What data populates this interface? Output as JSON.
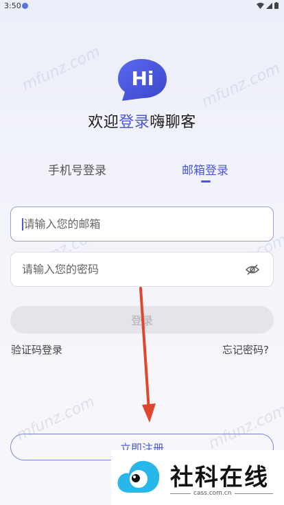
{
  "status_bar": {
    "time": "3:50"
  },
  "logo": {
    "text": "Hi",
    "color": "#4b57d6"
  },
  "welcome": {
    "prefix": "欢迎",
    "accent": "登录",
    "suffix": "嗨聊客"
  },
  "tabs": [
    {
      "label": "手机号登录",
      "active": false
    },
    {
      "label": "邮箱登录",
      "active": true
    }
  ],
  "email_field": {
    "placeholder": "请输入您的邮箱",
    "value": ""
  },
  "password_field": {
    "placeholder": "请输入您的密码",
    "value": ""
  },
  "login_button": {
    "label": "登录"
  },
  "links": {
    "code_login": "验证码登录",
    "forgot_password": "忘记密码?"
  },
  "register_button": {
    "label": "立即注册"
  },
  "watermark": {
    "text": "mfunz.com"
  },
  "overlay": {
    "title": "社科在线",
    "domain": "cass.com.cn"
  },
  "colors": {
    "accent": "#4b57d6",
    "arrow": "#e0462c"
  }
}
